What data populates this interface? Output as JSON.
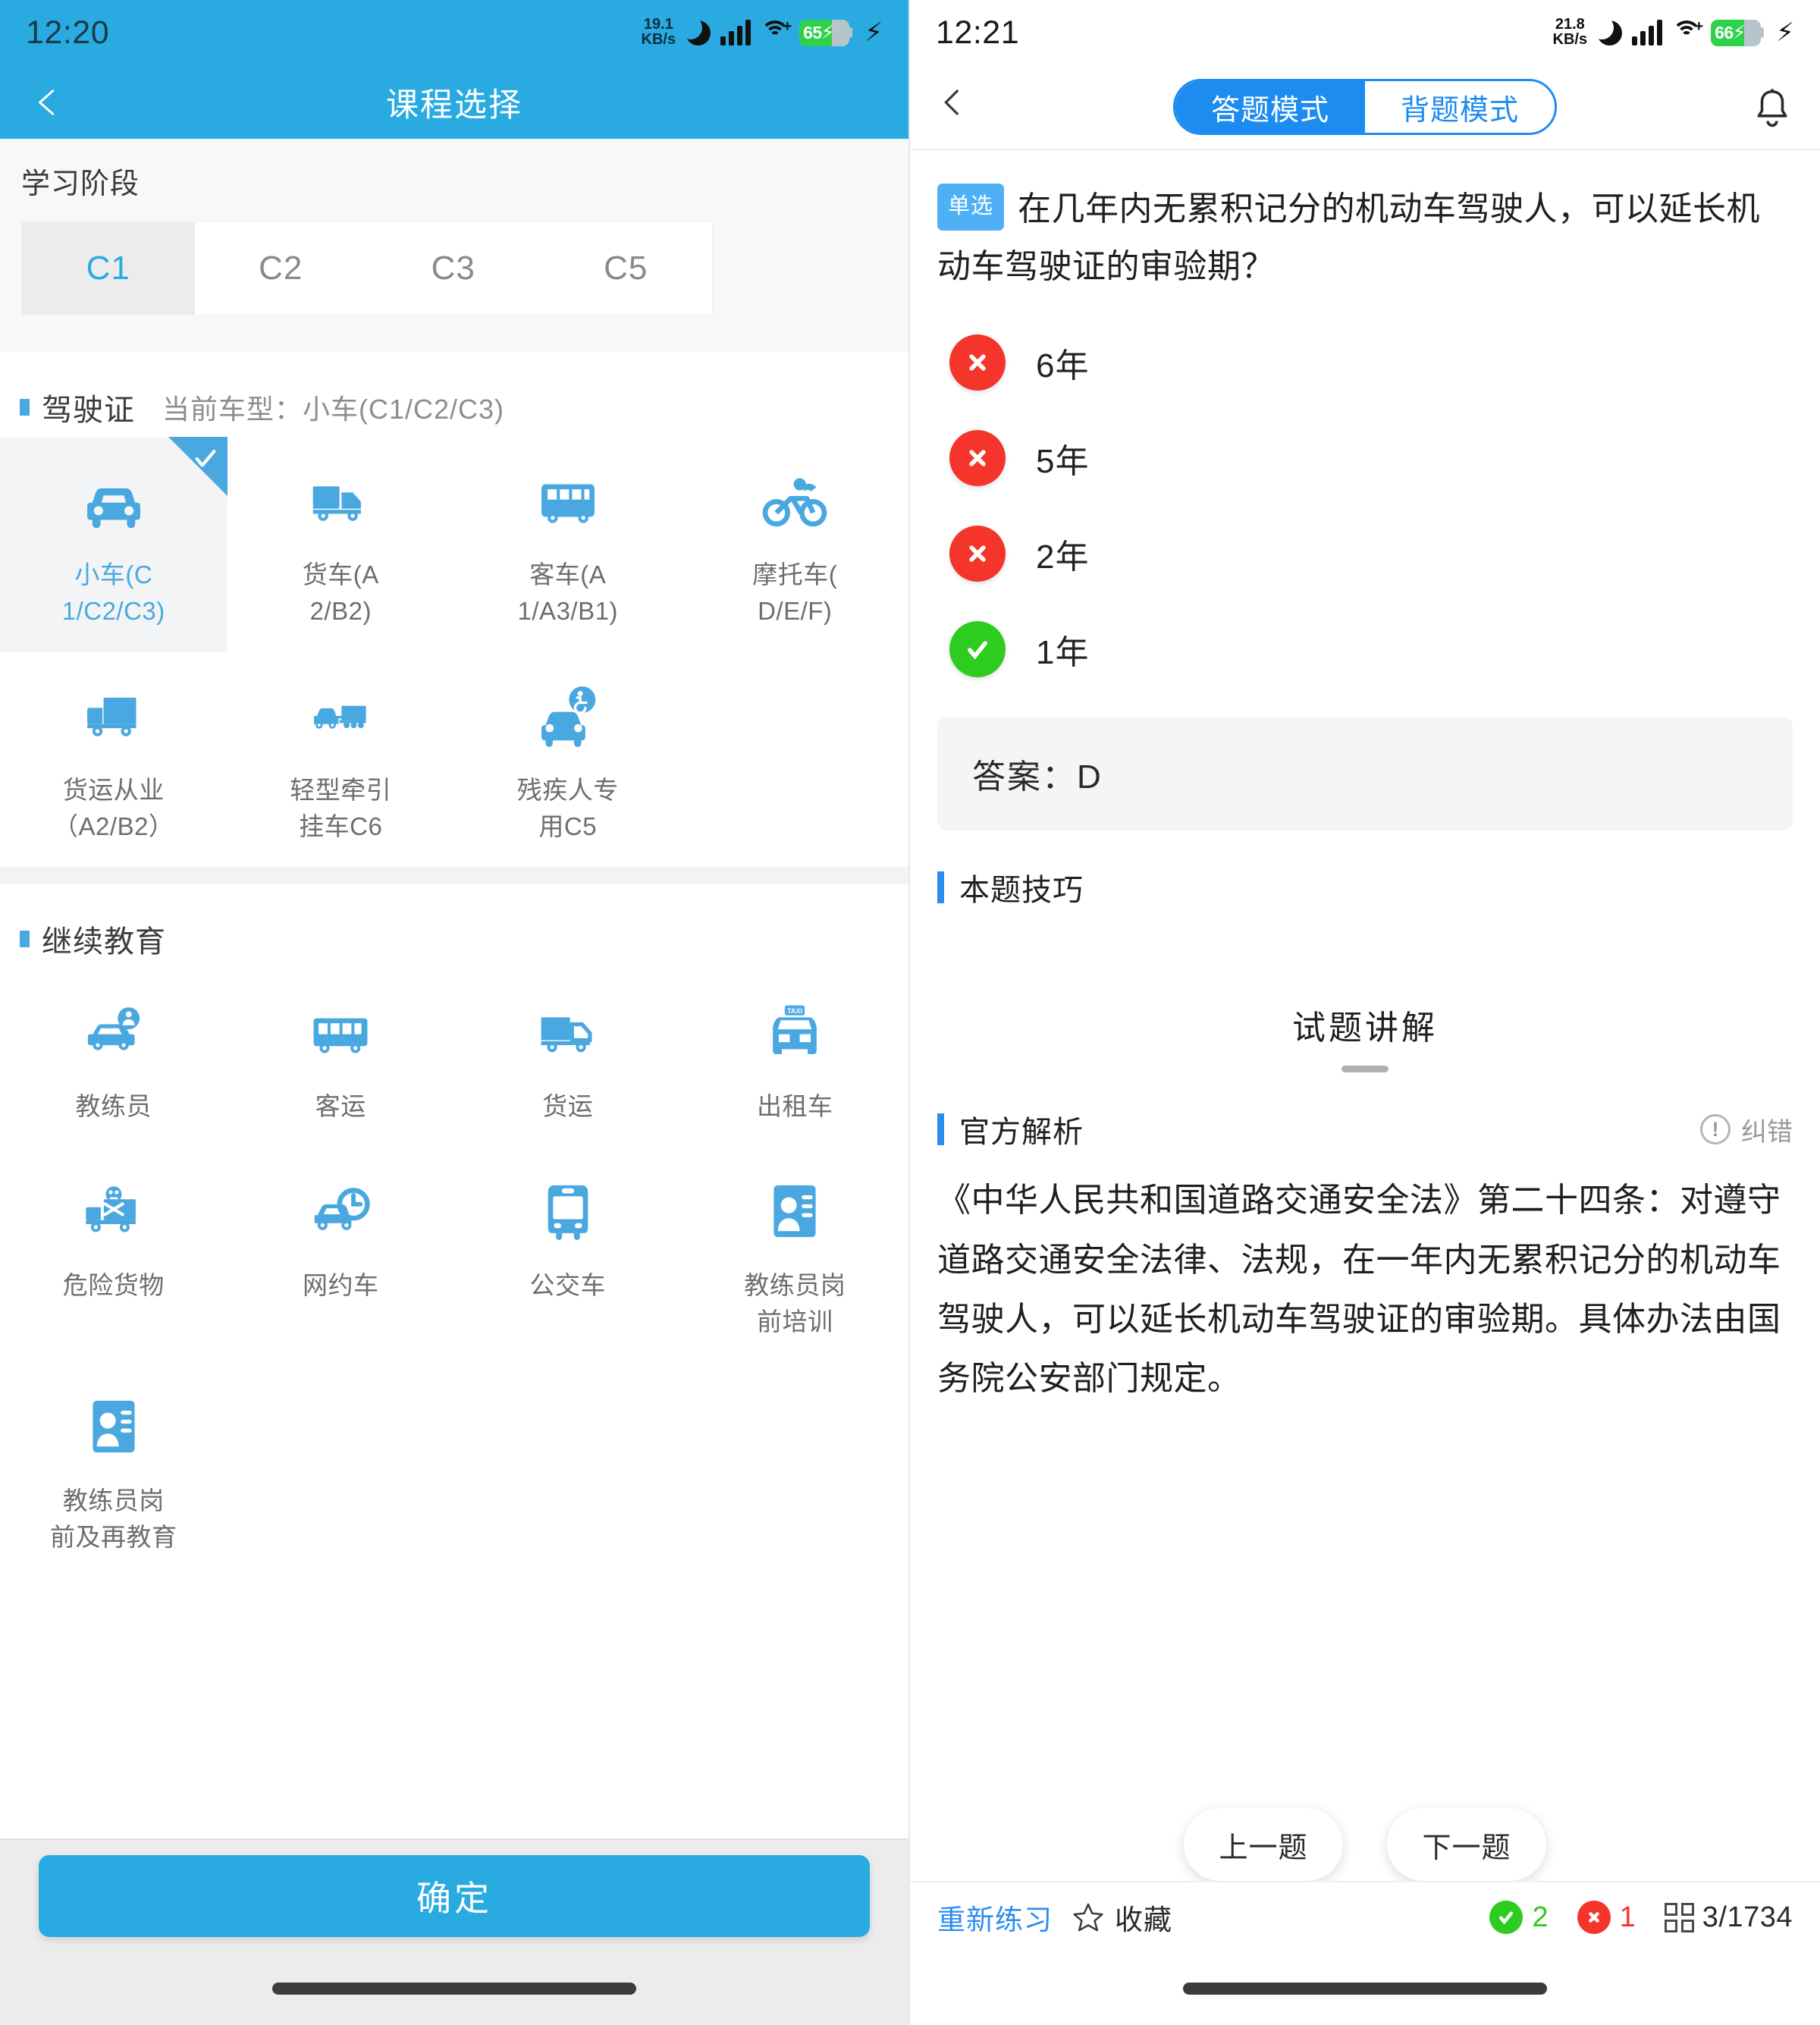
{
  "left": {
    "status": {
      "time": "12:20",
      "net_speed_value": "19.1",
      "net_speed_unit": "KB/s",
      "battery": "65"
    },
    "navbar": {
      "title": "课程选择",
      "back_icon": "arrow-left-icon"
    },
    "stage_section": {
      "label": "学习阶段",
      "tabs": [
        "C1",
        "C2",
        "C3",
        "C5"
      ],
      "active": "C1"
    },
    "license_section": {
      "title": "驾驶证",
      "subtitle": "当前车型：小车(C1/C2/C3)",
      "items": [
        {
          "line1": "小车(C",
          "line2": "1/C2/C3)",
          "icon": "car-icon",
          "selected": true
        },
        {
          "line1": "货车(A",
          "line2": "2/B2)",
          "icon": "truck-icon",
          "selected": false
        },
        {
          "line1": "客车(A",
          "line2": "1/A3/B1)",
          "icon": "bus-icon",
          "selected": false
        },
        {
          "line1": "摩托车(",
          "line2": "D/E/F)",
          "icon": "motorcycle-icon",
          "selected": false
        },
        {
          "line1": "货运从业",
          "line2": "（A2/B2）",
          "icon": "box-truck-icon",
          "selected": false
        },
        {
          "line1": "轻型牵引",
          "line2": "挂车C6",
          "icon": "car-trailer-icon",
          "selected": false
        },
        {
          "line1": "残疾人专",
          "line2": "用C5",
          "icon": "wheelchair-car-icon",
          "selected": false
        }
      ]
    },
    "edu_section": {
      "title": "继续教育",
      "items": [
        {
          "line1": "教练员",
          "line2": "",
          "icon": "instructor-car-icon"
        },
        {
          "line1": "客运",
          "line2": "",
          "icon": "minibus-icon"
        },
        {
          "line1": "货运",
          "line2": "",
          "icon": "cargo-truck-icon"
        },
        {
          "line1": "出租车",
          "line2": "",
          "icon": "taxi-icon"
        },
        {
          "line1": "危险货物",
          "line2": "",
          "icon": "hazmat-truck-icon"
        },
        {
          "line1": "网约车",
          "line2": "",
          "icon": "ride-hailing-icon"
        },
        {
          "line1": "公交车",
          "line2": "",
          "icon": "city-bus-icon"
        },
        {
          "line1": "教练员岗",
          "line2": "前培训",
          "icon": "id-card-icon"
        },
        {
          "line1": "教练员岗",
          "line2": "前及再教育",
          "icon": "id-card-icon"
        }
      ]
    },
    "confirm_label": "确定"
  },
  "right": {
    "status": {
      "time": "12:21",
      "net_speed_value": "21.8",
      "net_speed_unit": "KB/s",
      "battery": "66"
    },
    "header": {
      "back_icon": "chevron-left-icon",
      "bell_icon": "bell-icon",
      "modes": [
        {
          "label": "答题模式",
          "active": true
        },
        {
          "label": "背题模式",
          "active": false
        }
      ]
    },
    "question": {
      "tag": "单选",
      "text": "在几年内无累积记分的机动车驾驶人，可以延长机动车驾驶证的审验期？",
      "options": [
        {
          "text": "6年",
          "state": "wrong"
        },
        {
          "text": "5年",
          "state": "wrong"
        },
        {
          "text": "2年",
          "state": "wrong"
        },
        {
          "text": "1年",
          "state": "right"
        }
      ],
      "answer_label": "答案：D"
    },
    "tips_section": {
      "title": "本题技巧"
    },
    "explain_header": {
      "title": "试题讲解"
    },
    "official": {
      "title": "官方解析",
      "report_label": "纠错",
      "report_icon": "exclamation-circle-icon",
      "body": "《中华人民共和国道路交通安全法》第二十四条：对遵守道路交通安全法律、法规，在一年内无累积记分的机动车驾驶人，可以延长机动车驾驶证的审验期。具体办法由国务院公安部门规定。"
    },
    "nav_buttons": {
      "prev": "上一题",
      "next": "下一题"
    },
    "bottom_bar": {
      "redo": "重新练习",
      "favorite": "收藏",
      "favorite_icon": "star-icon",
      "correct_count": "2",
      "wrong_count": "1",
      "grid_icon": "grid-icon",
      "progress": "3/1734"
    }
  },
  "colors": {
    "brand_blue": "#29abe2",
    "icon_blue": "#4aa8e0",
    "mode_blue": "#1d8cf0",
    "wrong_red": "#f5342c",
    "right_green": "#2ecc1e"
  }
}
